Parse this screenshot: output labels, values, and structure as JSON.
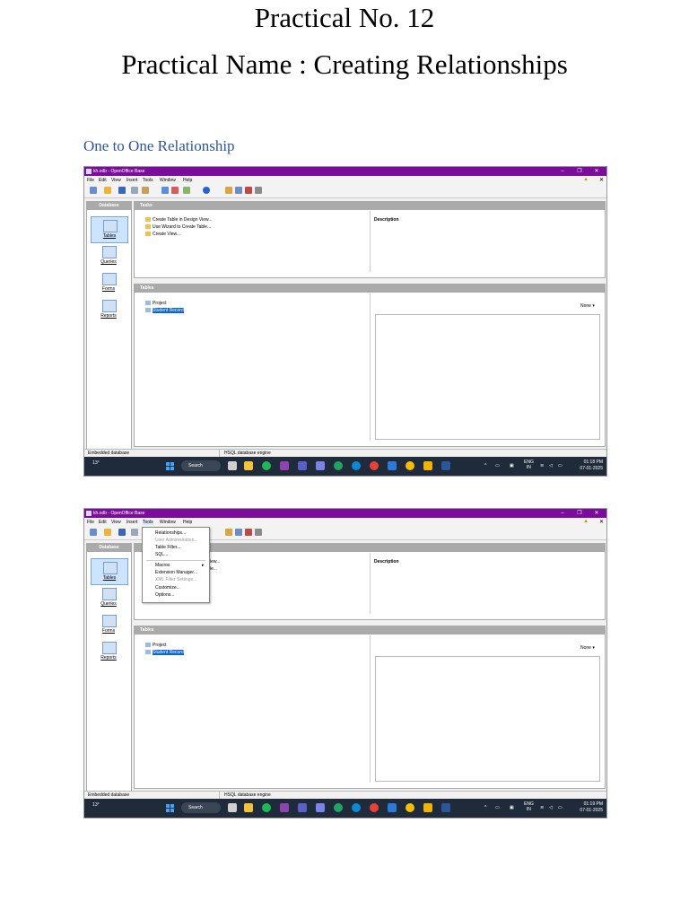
{
  "document": {
    "title": "Practical No. 12",
    "subtitle": "Practical Name : Creating Relationships",
    "section_heading": "One to One Relationship"
  },
  "window": {
    "title": "kh.odb - OpenOffice Base",
    "menu": [
      "File",
      "Edit",
      "View",
      "Insert",
      "Tools",
      "Window",
      "Help"
    ],
    "accent_color": "#7b0c9c"
  },
  "left_panel": {
    "header": "Database",
    "items": [
      "Tables",
      "Queries",
      "Forms",
      "Reports"
    ],
    "selected": "Tables"
  },
  "tasks_pane": {
    "header": "Tasks",
    "items": [
      "Create Table in Design View...",
      "Use Wizard to Create Table...",
      "Create View..."
    ],
    "description_label": "Description"
  },
  "tables_pane": {
    "header": "Tables",
    "items": [
      "Project",
      "Student Record"
    ],
    "selected": "Student Record",
    "preview_mode": "None"
  },
  "status_bar": {
    "left": "Embedded database",
    "right": "HSQL database engine"
  },
  "taskbar": {
    "weather_temp": "13°",
    "search_label": "Search",
    "lang_top": "ENG",
    "lang_bottom": "IN"
  },
  "screenshots": [
    {
      "time": "01:18 PM",
      "date": "07-01-2025"
    },
    {
      "time": "01:19 PM",
      "date": "07-01-2025"
    }
  ],
  "tools_menu": {
    "items": [
      {
        "label": "Relationships...",
        "enabled": true
      },
      {
        "label": "User Administration...",
        "enabled": false
      },
      {
        "label": "Table Filter...",
        "enabled": true
      },
      {
        "label": "SQL...",
        "enabled": true
      },
      {
        "label": "Macros",
        "enabled": true
      },
      {
        "label": "Extension Manager...",
        "enabled": true
      },
      {
        "label": "XML Filter Settings...",
        "enabled": false
      },
      {
        "label": "Customize...",
        "enabled": true
      },
      {
        "label": "Options...",
        "enabled": true
      }
    ],
    "partial_task_1": "iew...",
    "partial_task_2": "le..."
  }
}
